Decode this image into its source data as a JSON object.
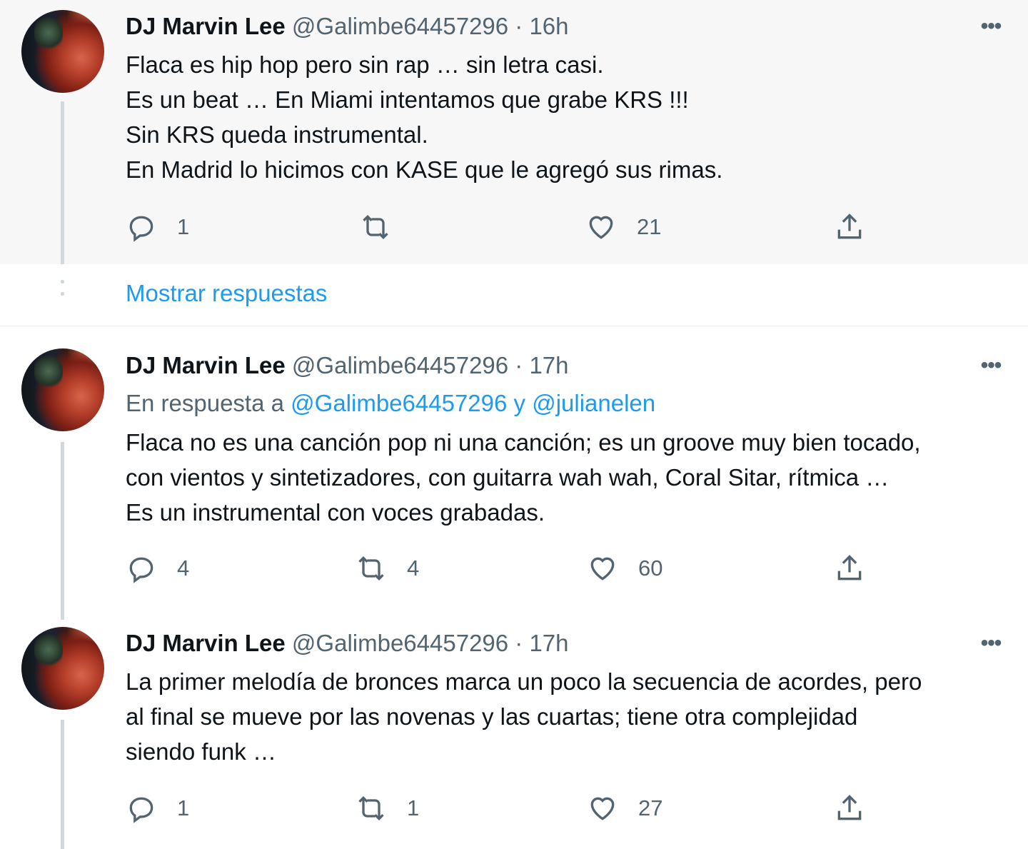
{
  "tweets": [
    {
      "name": "DJ Marvin Lee",
      "meta": "@Galimbe64457296 · 16h",
      "more": "•••",
      "text": "Flaca es hip hop pero sin rap … sin letra casi.\nEs un beat … En Miami intentamos que grabe KRS !!!\nSin KRS queda instrumental.\nEn Madrid lo hicimos con KASE que le agregó sus rimas.",
      "replies": "1",
      "retweets": "",
      "likes": "21"
    },
    {
      "name": "DJ Marvin Lee",
      "meta": "@Galimbe64457296 · 17h",
      "more": "•••",
      "reply_prefix": "En respuesta a",
      "reply_link": "@Galimbe64457296 y @julianelen",
      "text": "Flaca no es una canción pop ni una canción; es un groove muy bien tocado,\ncon vientos y sintetizadores, con guitarra wah wah, Coral Sitar, rítmica …\nEs un instrumental con voces grabadas.",
      "replies": "4",
      "retweets": "4",
      "likes": "60"
    },
    {
      "name": "DJ Marvin Lee",
      "meta": "@Galimbe64457296 · 17h",
      "more": "•••",
      "text": "La primer melodía de bronces marca un poco la secuencia de acordes, pero\nal final se mueve por las novenas y las cuartas; tiene otra complejidad\nsiendo funk …",
      "replies": "1",
      "retweets": "1",
      "likes": "27"
    }
  ],
  "show_replies": "Mostrar respuestas",
  "colors": {
    "link": "#1d9bf0",
    "muted": "#536471",
    "thread_line": "#cfd9de",
    "highlight_bg": "#f7f7f7"
  }
}
